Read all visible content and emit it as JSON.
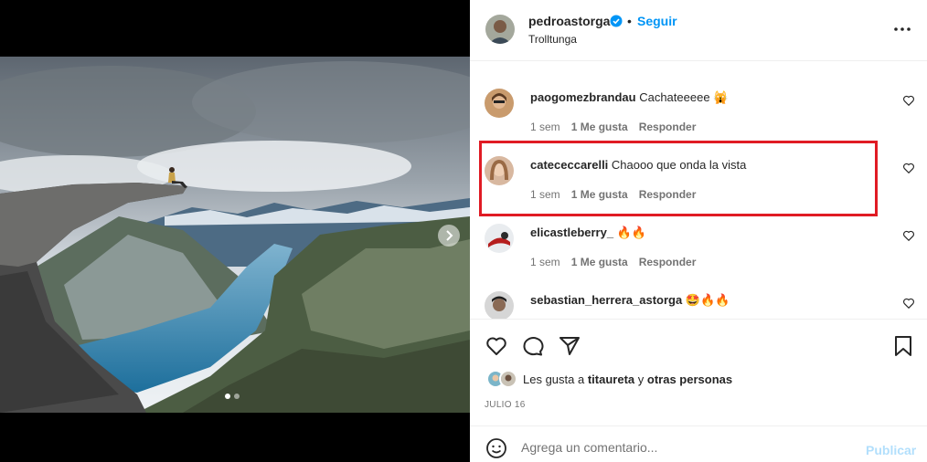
{
  "post": {
    "username": "pedroastorga",
    "follow_label": "Seguir",
    "separator": "•",
    "location": "Trolltunga"
  },
  "comments": [
    {
      "username": "paogomezbrandau",
      "text": "Cachateeeee 🙀",
      "time": "1 sem",
      "likes": "1 Me gusta",
      "reply": "Responder"
    },
    {
      "username": "catececcarelli",
      "text": "Chaooo que onda la vista",
      "time": "1 sem",
      "likes": "1 Me gusta",
      "reply": "Responder"
    },
    {
      "username": "elicastleberry_",
      "text": "🔥🔥",
      "time": "1 sem",
      "likes": "1 Me gusta",
      "reply": "Responder"
    },
    {
      "username": "sebastian_herrera_astorga",
      "text": "🤩🔥🔥"
    }
  ],
  "likes": {
    "prefix": "Les gusta a",
    "user": "titaureta",
    "joiner": "y",
    "rest": "otras personas"
  },
  "date": "JULIO 16",
  "composer": {
    "placeholder": "Agrega un comentario...",
    "publish_label": "Publicar"
  },
  "carousel": {
    "count": 2,
    "active": 0
  },
  "colors": {
    "accent": "#0095f6",
    "highlight": "#e01b24",
    "publish_disabled": "#b2dffc"
  },
  "icons": [
    "chevron-right-icon",
    "verified-badge-icon",
    "more-options-icon",
    "heart-icon",
    "comment-icon",
    "share-icon",
    "bookmark-icon",
    "emoji-icon"
  ]
}
